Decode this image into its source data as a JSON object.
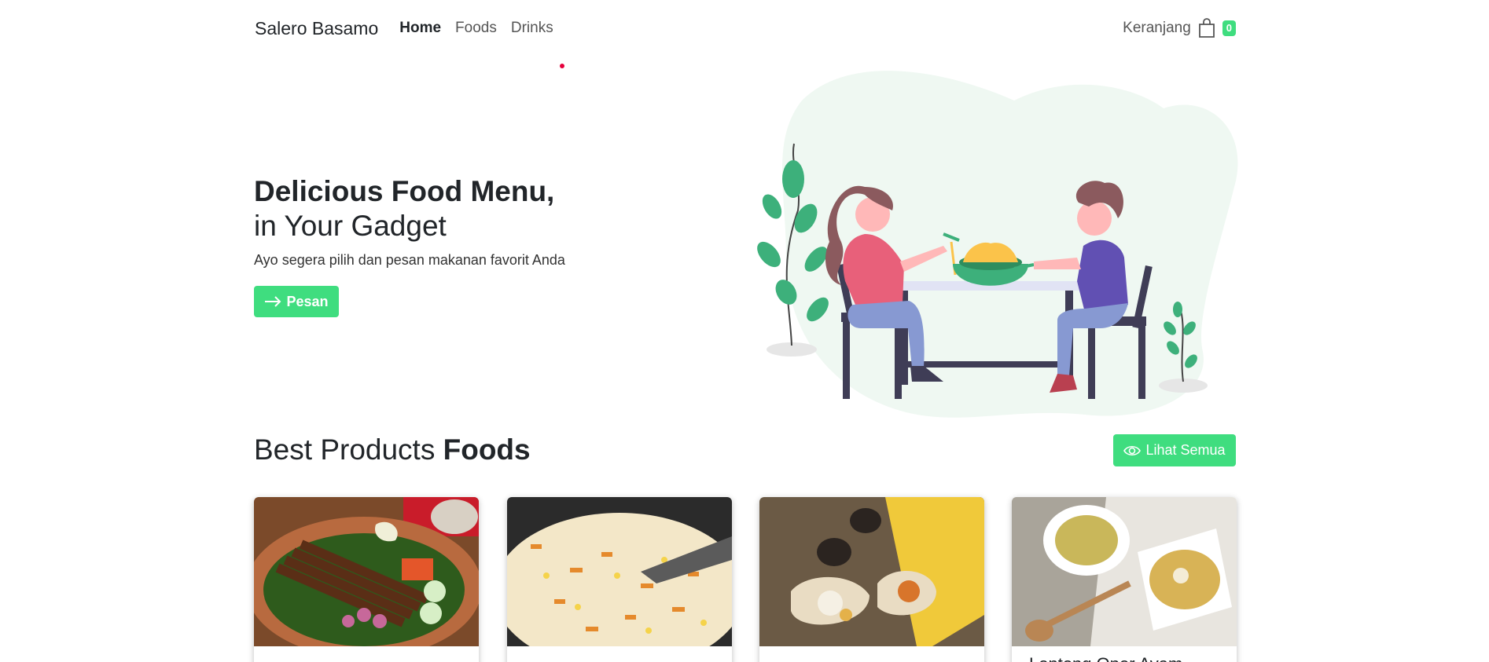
{
  "nav": {
    "brand": "Salero Basamo",
    "links": [
      "Home",
      "Foods",
      "Drinks"
    ],
    "cart_label": "Keranjang",
    "cart_count": "0"
  },
  "hero": {
    "title": "Delicious Food Menu,",
    "subtitle": "in Your Gadget",
    "description": "Ayo segera pilih dan pesan makanan favorit Anda",
    "button_label": "Pesan"
  },
  "best_products": {
    "title_regular": "Best Products",
    "title_bold": "Foods",
    "button_label": "Lihat Semua",
    "cards": [
      {
        "label": ""
      },
      {
        "label": ""
      },
      {
        "label": ""
      },
      {
        "label": "Lontong Opor Ayam"
      }
    ]
  },
  "colors": {
    "accent": "#3fdd7f",
    "text": "#212529",
    "blob": "#eff8f2",
    "plant": "#3db07b",
    "dot": "#e6003c"
  }
}
